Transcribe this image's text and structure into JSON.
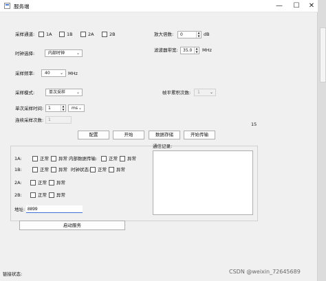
{
  "window": {
    "title": "服务端",
    "minimize": "—",
    "maximize": "☐",
    "close": "✕"
  },
  "sampling_channel": {
    "label": "采样通道:",
    "options": [
      "1A",
      "1B",
      "2A",
      "2B"
    ]
  },
  "amp_gain": {
    "label": "放大倍数:",
    "value": "0",
    "unit": "dB"
  },
  "clock_select": {
    "label": "时钟选择:",
    "value": "内部时钟"
  },
  "filter_bw": {
    "label": "滤波器带宽:",
    "value": "35.0",
    "unit": "MHz"
  },
  "sample_rate": {
    "label": "采样频率:",
    "value": "40",
    "unit": "MHz"
  },
  "sample_mode": {
    "label": "采样模式:",
    "value": "单次采样"
  },
  "avg_count": {
    "label": "帧平累积次数:",
    "value": "1"
  },
  "single_time": {
    "label": "单次采样时间:",
    "value": "1",
    "unit": "ms"
  },
  "continuous_count": {
    "label": "连续采样次数:",
    "value": "1"
  },
  "counter": "15",
  "buttons": {
    "config": "配置",
    "start": "开始",
    "save": "数据存储",
    "transfer": "开始传输",
    "start_service": "启动服务"
  },
  "status": {
    "rows": [
      {
        "label": "1A:",
        "normal": "正常",
        "abnormal": "异常",
        "extra_label": "内部数据传输:",
        "extra_normal": "正常",
        "extra_abnormal": "异常"
      },
      {
        "label": "1B:",
        "normal": "正常",
        "abnormal": "异常",
        "extra_label": "时钟状态:",
        "extra_normal": "正常",
        "extra_abnormal": "异常"
      },
      {
        "label": "2A:",
        "normal": "正常",
        "abnormal": "异常"
      },
      {
        "label": "2B:",
        "normal": "正常",
        "abnormal": "异常"
      }
    ]
  },
  "comm_log": {
    "label": "通信记录:"
  },
  "address": {
    "label": "地址:",
    "value": "8899"
  },
  "statusbar": {
    "label": "链接状态:"
  },
  "watermark": "CSDN @weixin_72645689"
}
